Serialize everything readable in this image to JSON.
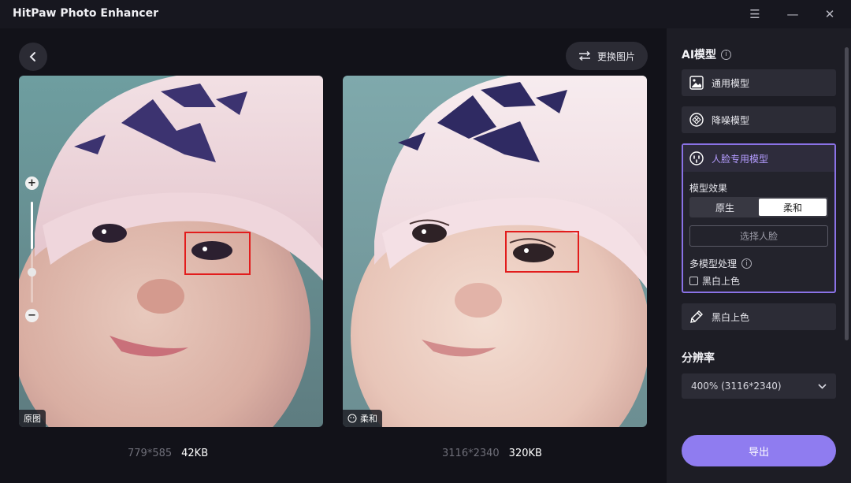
{
  "app": {
    "title": "HitPaw Photo Enhancer"
  },
  "window_controls": {
    "menu_icon": "☰",
    "minimize_icon": "—",
    "close_icon": "✕"
  },
  "toolbar": {
    "replace_label": "更换图片"
  },
  "preview": {
    "left_tag": "原图",
    "right_tag": "柔和",
    "left_dims": "779*585",
    "left_size": "42KB",
    "right_dims": "3116*2340",
    "right_size": "320KB"
  },
  "sidebar": {
    "ai_model_title": "AI模型",
    "models": [
      {
        "label": "通用模型",
        "icon": "image-icon"
      },
      {
        "label": "降噪模型",
        "icon": "denoise-icon"
      },
      {
        "label": "人脸专用模型",
        "icon": "face-icon"
      },
      {
        "label": "黑白上色",
        "icon": "colorize-icon"
      }
    ],
    "model_effect_label": "模型效果",
    "effect_options": [
      "原生",
      "柔和"
    ],
    "effect_selected": "柔和",
    "select_face_label": "选择人脸",
    "multi_model_label": "多模型处理",
    "colorize_checkbox_label": "黑白上色",
    "colorize_checked": false,
    "resolution_title": "分辨率",
    "resolution_value": "400% (3116*2340)",
    "export_label": "导出"
  },
  "colors": {
    "accent": "#8f7cf0",
    "highlight_box": "#e21c1c",
    "background": "#121219"
  }
}
